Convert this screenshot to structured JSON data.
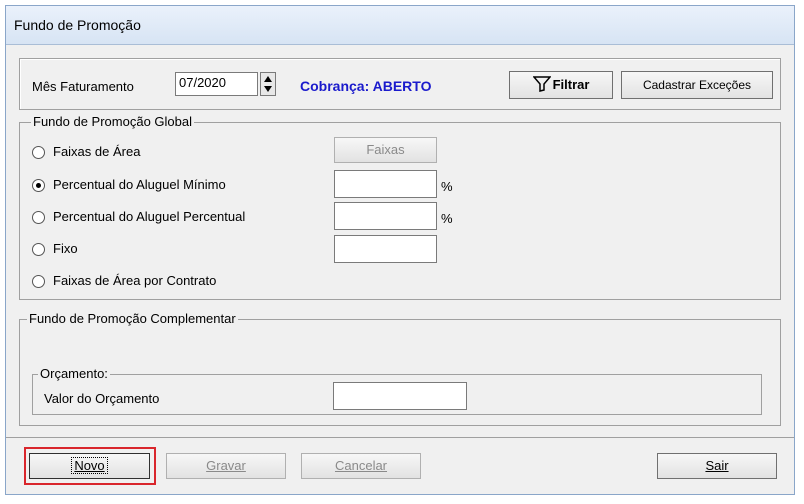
{
  "window": {
    "title": "Fundo de Promoção"
  },
  "header": {
    "mes_label": "Mês Faturamento",
    "mes_value": "07/2020",
    "cobranca": "Cobrança: ABERTO",
    "filtrar_label": "Filtrar",
    "cadastrar_label": "Cadastrar Exceções"
  },
  "global": {
    "legend": "Fundo de Promoção Global",
    "options": [
      {
        "label": "Faixas de Área",
        "selected": false
      },
      {
        "label": "Percentual do Aluguel Mínimo",
        "selected": true
      },
      {
        "label": "Percentual do Aluguel Percentual",
        "selected": false
      },
      {
        "label": "Fixo",
        "selected": false
      },
      {
        "label": "Faixas de Área por Contrato",
        "selected": false
      }
    ],
    "faixas_button": "Faixas",
    "pct_symbol": "%",
    "minimo_value": "",
    "percentual_value": "",
    "fixo_value": ""
  },
  "complementar": {
    "legend": "Fundo de Promoção Complementar",
    "orcamento_legend": "Orçamento:",
    "valor_label": "Valor do Orçamento",
    "valor_value": ""
  },
  "footer": {
    "novo": "Novo",
    "gravar": "Gravar",
    "cancelar": "Cancelar",
    "sair": "Sair"
  },
  "colors": {
    "highlight": "#d9262c",
    "accent": "#1a1acc"
  }
}
